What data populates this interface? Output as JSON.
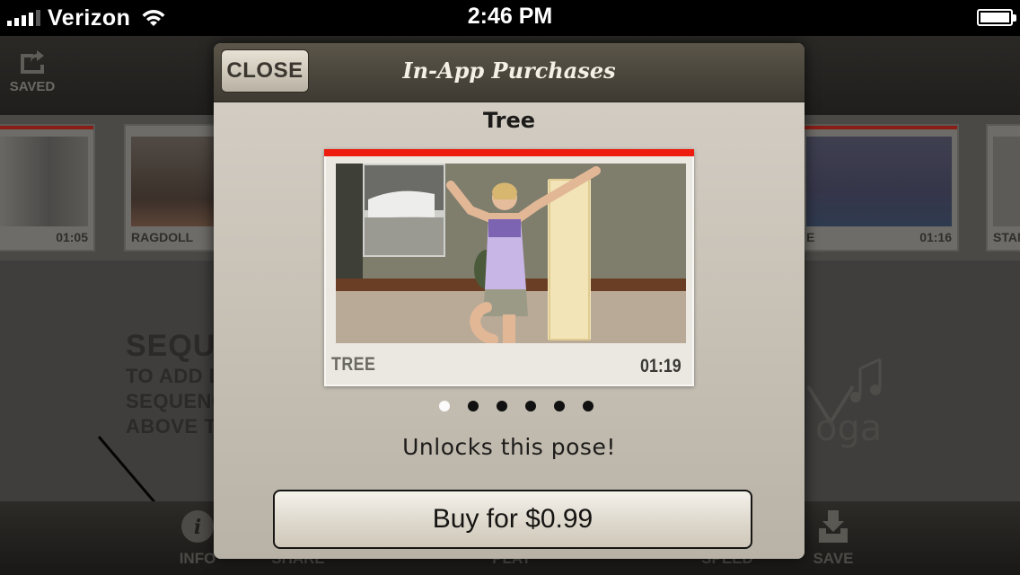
{
  "status_bar": {
    "carrier": "Verizon",
    "time": "2:46 PM"
  },
  "background_app": {
    "saved_label": "SAVED",
    "strip_items": [
      {
        "label": "",
        "duration": "01:05"
      },
      {
        "label": "RAGDOLL",
        "duration": ""
      },
      {
        "label": "E",
        "duration": "01:16"
      },
      {
        "label": "STAN",
        "duration": ""
      }
    ],
    "sequence_title": "SEQUEN",
    "sequence_lines": [
      "TO ADD EIT",
      "SEQUENCE",
      "ABOVE TO"
    ],
    "tabs": [
      {
        "label": "INFO",
        "icon": "info-icon"
      },
      {
        "label": "SHARE",
        "icon": "share-icon"
      },
      {
        "label": "PLAY",
        "icon": "play-icon"
      },
      {
        "label": "SPEED",
        "icon": "speed-icon"
      },
      {
        "label": "SAVE",
        "icon": "save-icon"
      }
    ]
  },
  "modal": {
    "close_label": "CLOSE",
    "title": "In-App Purchases",
    "pose_name": "Tree",
    "card": {
      "label": "TREE",
      "duration": "01:19",
      "accent_color": "#ee1b0f"
    },
    "page_count": 6,
    "active_page": 0,
    "description": "Unlocks this pose!",
    "buy_label": "Buy for $0.99"
  }
}
